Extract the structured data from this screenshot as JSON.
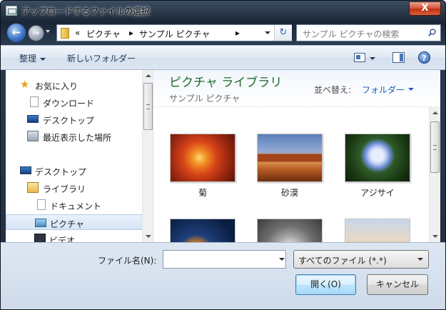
{
  "window": {
    "title": "アップロードするファイルの選択",
    "close_label": "X"
  },
  "nav": {
    "back_label": "←",
    "forward_label": "→",
    "breadcrumb": [
      {
        "label": "«"
      },
      {
        "label": "ピクチャ"
      },
      {
        "label": "▸"
      },
      {
        "label": "サンプル ピクチャ"
      },
      {
        "label": "▸"
      }
    ],
    "refresh_label": "↻",
    "search_placeholder": "サンプル ピクチャの検索"
  },
  "toolbar": {
    "organize_label": "整理",
    "new_folder_label": "新しいフォルダー",
    "help_label": "?"
  },
  "navpane": {
    "items": [
      {
        "label": "お気に入り",
        "icon": "star-icon"
      },
      {
        "label": "ダウンロード",
        "icon": "download-folder-icon"
      },
      {
        "label": "デスクトップ",
        "icon": "desktop-icon"
      },
      {
        "label": "最近表示した場所",
        "icon": "recent-places-icon"
      },
      {
        "label": "デスクトップ",
        "icon": "desktop-icon"
      },
      {
        "label": "ライブラリ",
        "icon": "library-icon"
      },
      {
        "label": "ドキュメント",
        "icon": "documents-icon"
      },
      {
        "label": "ピクチャ",
        "icon": "pictures-icon",
        "selected": true
      },
      {
        "label": "ビデオ",
        "icon": "videos-icon"
      }
    ]
  },
  "library": {
    "title": "ピクチャ ライブラリ",
    "subtitle": "サンプル ピクチャ",
    "arrange_label": "並べ替え:",
    "arrange_value": "フォルダー",
    "files": [
      {
        "name": "菊"
      },
      {
        "name": "砂漠"
      },
      {
        "name": "アジサイ"
      },
      {
        "name": ""
      },
      {
        "name": ""
      },
      {
        "name": ""
      }
    ]
  },
  "bottom": {
    "filename_label": "ファイル名(N):",
    "filename_value": "",
    "filetype_value": "すべてのファイル (*.*)",
    "open_label": "開く(O)",
    "cancel_label": "キャンセル"
  },
  "colors": {
    "library_title": "#1e6a2b",
    "link_blue": "#1c5db8",
    "close_red": "#c23112"
  }
}
